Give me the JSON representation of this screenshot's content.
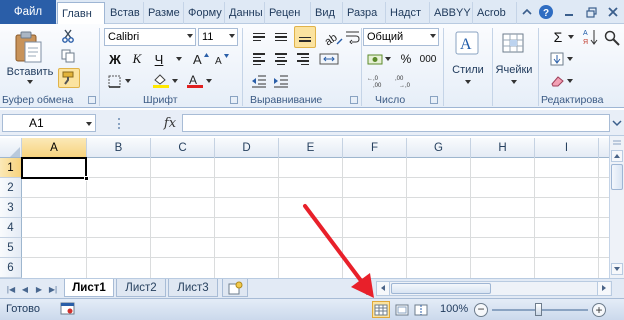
{
  "ribbon_tabs": {
    "file": "Файл",
    "items": [
      "Главн",
      "Встав",
      "Разме",
      "Форму",
      "Данны",
      "Рецен",
      "Вид",
      "Разра",
      "Надст",
      "ABBYY",
      "Acrob"
    ]
  },
  "clipboard": {
    "paste_label": "Вставить",
    "group_label": "Буфер обмена"
  },
  "font": {
    "name": "Calibri",
    "size": "11",
    "bold": "Ж",
    "italic": "К",
    "underline": "Ч",
    "group_label": "Шрифт"
  },
  "alignment": {
    "group_label": "Выравнивание"
  },
  "number": {
    "format": "Общий",
    "percent": "%",
    "thousands": "000",
    "group_label": "Число"
  },
  "styles": {
    "label": "Стили"
  },
  "cells": {
    "label": "Ячейки"
  },
  "editing": {
    "sum": "Σ",
    "group_label": "Редактирова"
  },
  "formula_bar": {
    "name_box": "A1",
    "fx": "fx",
    "value": ""
  },
  "grid": {
    "columns": [
      "A",
      "B",
      "C",
      "D",
      "E",
      "F",
      "G",
      "H",
      "I"
    ],
    "rows": [
      "1",
      "2",
      "3",
      "4",
      "5",
      "6"
    ],
    "selected_cell": "A1"
  },
  "sheets": {
    "tabs": [
      "Лист1",
      "Лист2",
      "Лист3"
    ],
    "active": "Лист1"
  },
  "status_bar": {
    "ready": "Готово",
    "zoom_percent": "100%",
    "zoom_minus": "−",
    "zoom_plus": "+"
  },
  "colors": {
    "file_tab": "#2a5ea8",
    "selection_header": "#f7d27c",
    "annotation_arrow": "#e8202a",
    "font_color_red": "#e02020",
    "highlight_yellow": "#ffe800"
  }
}
